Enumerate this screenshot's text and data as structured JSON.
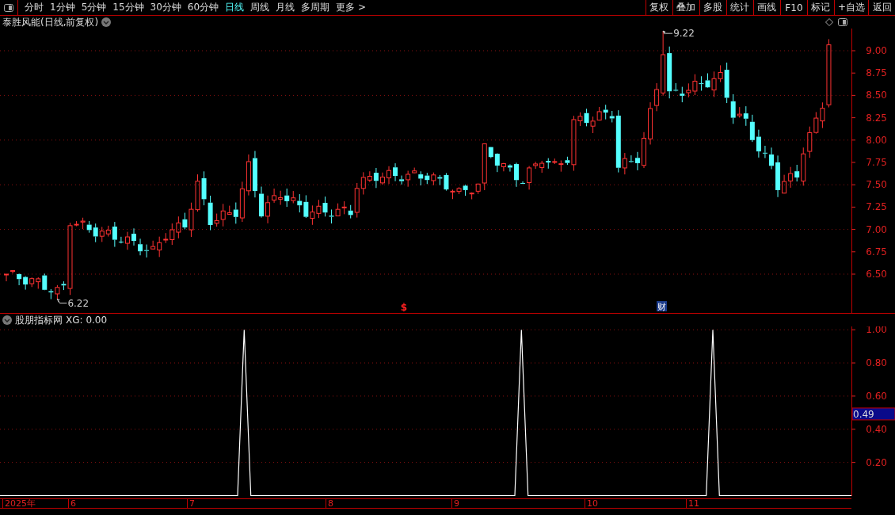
{
  "toolbar": {
    "periods": [
      {
        "label": "分时",
        "selected": false
      },
      {
        "label": "1分钟",
        "selected": false
      },
      {
        "label": "5分钟",
        "selected": false
      },
      {
        "label": "15分钟",
        "selected": false
      },
      {
        "label": "30分钟",
        "selected": false
      },
      {
        "label": "60分钟",
        "selected": false
      },
      {
        "label": "日线",
        "selected": true
      },
      {
        "label": "周线",
        "selected": false
      },
      {
        "label": "月线",
        "selected": false
      },
      {
        "label": "多周期",
        "selected": false
      },
      {
        "label": "更多 >",
        "selected": false
      }
    ],
    "buttons": [
      "复权",
      "叠加",
      "多股",
      "统计",
      "画线",
      "F10",
      "标记",
      "+自选",
      "返回"
    ]
  },
  "price_panel": {
    "title": "泰胜风能(日线,前复权)",
    "price_labels": [
      "9.00",
      "8.75",
      "8.50",
      "8.25",
      "8.00",
      "7.75",
      "7.50",
      "7.25",
      "7.00",
      "6.75",
      "6.50"
    ],
    "annotations": [
      {
        "kind": "high",
        "text": "9.22"
      },
      {
        "kind": "low",
        "text": "6.22"
      }
    ],
    "markers": [
      {
        "kind": "signal",
        "text": "$"
      },
      {
        "kind": "news",
        "text": "财"
      }
    ]
  },
  "indicator_panel": {
    "title": "股朋指标网",
    "legend_value": ": 0.00",
    "cursor_value": "0.49",
    "chart_data": {
      "type": "line",
      "ylim": [
        0,
        1.02
      ],
      "grid": true,
      "yticks": [
        {
          "value": 0.2,
          "label": "0.20"
        },
        {
          "value": 0.4,
          "label": "0.40"
        },
        {
          "value": 0.6,
          "label": "0.60"
        },
        {
          "value": 0.8,
          "label": "0.80"
        },
        {
          "value": 1,
          "label": "1.00"
        }
      ],
      "series": [
        {
          "name": "XG",
          "color": "#ffffff",
          "values": [
            0,
            0,
            0,
            0,
            0,
            0,
            0,
            0,
            0,
            0,
            0,
            0,
            0,
            0,
            0,
            0,
            0,
            0,
            0,
            0,
            0,
            0,
            0,
            0,
            0,
            0,
            0,
            0,
            0,
            0,
            0,
            0,
            0,
            0,
            0,
            0,
            0,
            1,
            0,
            0,
            0,
            0,
            0,
            0,
            0,
            0,
            0,
            0,
            0,
            0,
            0,
            0,
            0,
            0,
            0,
            0,
            0,
            0,
            0,
            0,
            0,
            0,
            0,
            0,
            0,
            0,
            0,
            0,
            0,
            0,
            0,
            0,
            0,
            0,
            0,
            0,
            0,
            0,
            0,
            1,
            0,
            0,
            0,
            0,
            0,
            0,
            0,
            0,
            0,
            0,
            0,
            0,
            0,
            0,
            0,
            0,
            0,
            0,
            0,
            0,
            0,
            0,
            0,
            0,
            0,
            0,
            0,
            0,
            1,
            0,
            0,
            0,
            0,
            0,
            0,
            0,
            0,
            0,
            0,
            0,
            0,
            0,
            0,
            0,
            0,
            0,
            0,
            0,
            0,
            0
          ]
        }
      ]
    }
  },
  "date_axis": {
    "labels": [
      "2025年",
      "6",
      "7",
      "8",
      "9",
      "10",
      "11"
    ]
  }
}
